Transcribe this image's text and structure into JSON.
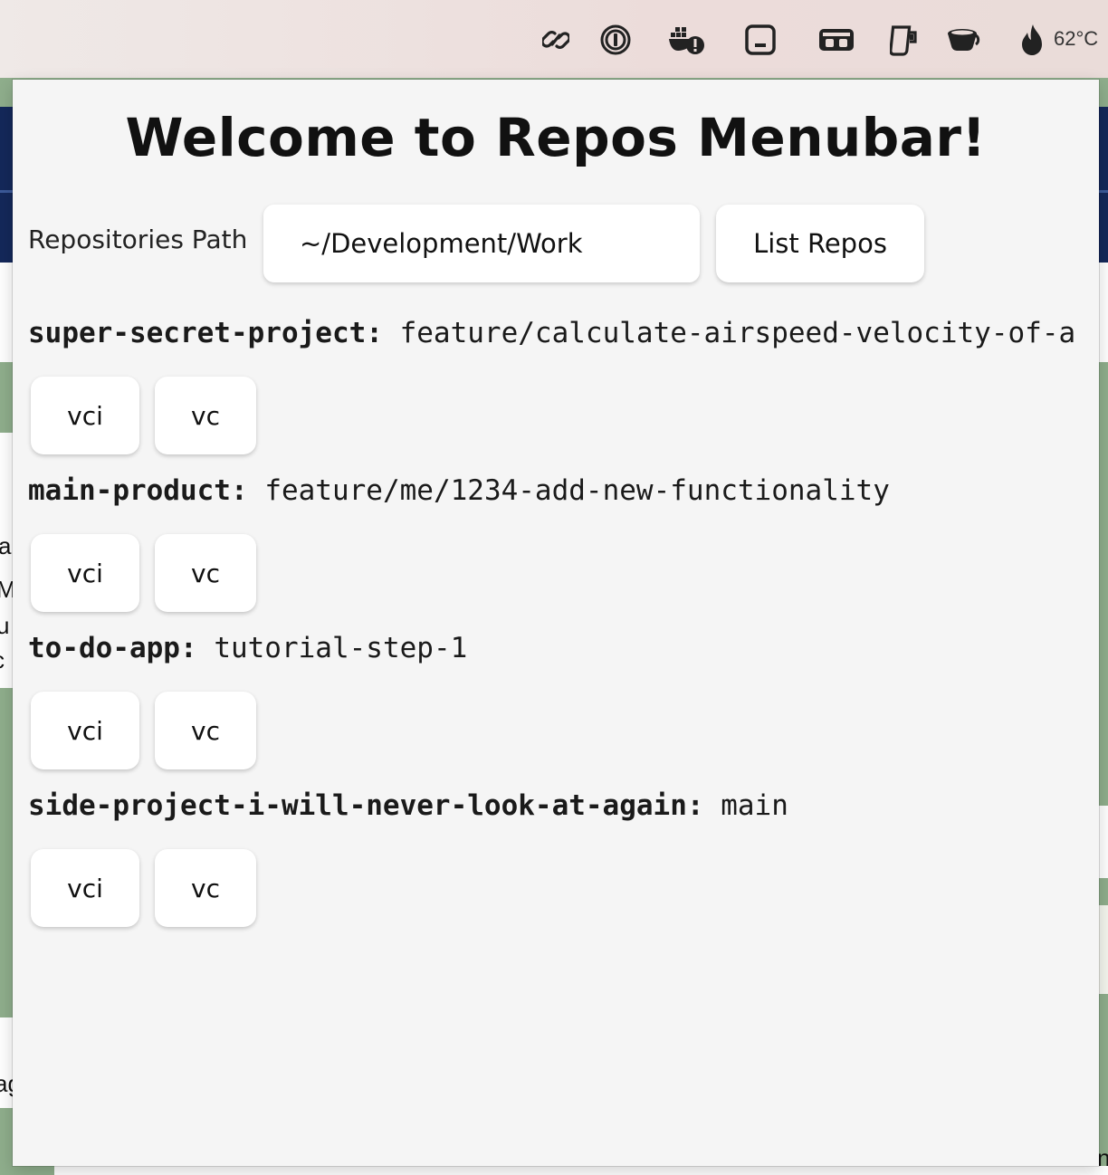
{
  "menubar": {
    "icons": [
      "link-icon",
      "password-manager-icon",
      "docker-warning-icon",
      "display-icon",
      "cassette-icon",
      "mug-icon",
      "coffee-cup-icon",
      "flame-icon"
    ],
    "temperature": "62°C"
  },
  "app": {
    "title": "Welcome to Repos Menubar!",
    "path_label": "Repositories Path",
    "path_value": "~/Development/Work",
    "list_button": "List Repos"
  },
  "repos": [
    {
      "name": "super-secret-project:",
      "branch": "feature/calculate-airspeed-velocity-of-a",
      "vci": "vci",
      "vc": "vc"
    },
    {
      "name": "main-product:",
      "branch": "feature/me/1234-add-new-functionality",
      "vci": "vci",
      "vc": "vc"
    },
    {
      "name": "to-do-app:",
      "branch": "tutorial-step-1",
      "vci": "vci",
      "vc": "vc"
    },
    {
      "name": "side-project-i-will-never-look-at-again:",
      "branch": "main",
      "vci": "vci",
      "vc": "vc"
    }
  ],
  "background": {
    "fragments": [
      "a",
      "M",
      "u",
      "c",
      "ag",
      "n"
    ]
  }
}
